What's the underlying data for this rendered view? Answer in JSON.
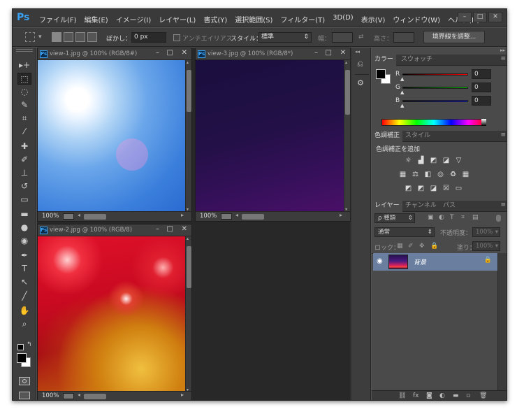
{
  "app": {
    "logo": "Ps",
    "menu": [
      "ファイル(F)",
      "編集(E)",
      "イメージ(I)",
      "レイヤー(L)",
      "書式(Y)",
      "選択範囲(S)",
      "フィルター(T)",
      "3D(D)",
      "表示(V)",
      "ウィンドウ(W)",
      "ヘルプ(H)"
    ],
    "window_buttons": [
      "–",
      "□",
      "✕"
    ]
  },
  "options": {
    "feather_label": "ぼかし：",
    "feather_value": "0 px",
    "antialias_label": "アンチエイリアス",
    "style_label": "スタイル：",
    "style_value": "標準",
    "width_label": "幅：",
    "height_label": "高さ：",
    "refine_button": "境界線を調整..."
  },
  "tools": [
    {
      "icon": "move-icon",
      "glyph": "▸+"
    },
    {
      "icon": "marquee-icon",
      "glyph": "⬚"
    },
    {
      "icon": "lasso-icon",
      "glyph": "◌"
    },
    {
      "icon": "quick-select-icon",
      "glyph": "✎"
    },
    {
      "icon": "crop-icon",
      "glyph": "⌗"
    },
    {
      "icon": "eyedropper-icon",
      "glyph": "⁄"
    },
    {
      "icon": "healing-brush-icon",
      "glyph": "✚"
    },
    {
      "icon": "brush-icon",
      "glyph": "✐"
    },
    {
      "icon": "stamp-icon",
      "glyph": "⊥"
    },
    {
      "icon": "history-brush-icon",
      "glyph": "↺"
    },
    {
      "icon": "eraser-icon",
      "glyph": "▭"
    },
    {
      "icon": "gradient-icon",
      "glyph": "▬"
    },
    {
      "icon": "blur-icon",
      "glyph": "●"
    },
    {
      "icon": "dodge-icon",
      "glyph": "◉"
    },
    {
      "icon": "pen-icon",
      "glyph": "✒"
    },
    {
      "icon": "type-icon",
      "glyph": "T"
    },
    {
      "icon": "path-select-icon",
      "glyph": "↖"
    },
    {
      "icon": "line-icon",
      "glyph": "╱"
    },
    {
      "icon": "hand-icon",
      "glyph": "✋"
    },
    {
      "icon": "zoom-icon",
      "glyph": "⌕"
    }
  ],
  "documents": [
    {
      "title": "view-1.jpg @ 100% (RGB/8#)",
      "zoom": "100%"
    },
    {
      "title": "view-3.jpg @ 100% (RGB/8*)",
      "zoom": "100%"
    },
    {
      "title": "view-2.jpg @ 100% (RGB/8)",
      "zoom": "100%"
    }
  ],
  "color_panel": {
    "tabs": [
      "カラー",
      "スウォッチ"
    ],
    "channels": [
      {
        "label": "R",
        "value": "0",
        "color": "#ff0000"
      },
      {
        "label": "G",
        "value": "0",
        "color": "#00cc00"
      },
      {
        "label": "B",
        "value": "0",
        "color": "#0000ff"
      }
    ]
  },
  "adjust_panel": {
    "tabs": [
      "色調補正",
      "スタイル"
    ],
    "subtitle": "色調補正を追加"
  },
  "layers_panel": {
    "tabs": [
      "レイヤー",
      "チャンネル",
      "パス"
    ],
    "filter_label": "ρ 種類",
    "blend_mode": "通常",
    "opacity_label": "不透明度：",
    "opacity_value": "100%",
    "lock_label": "ロック：",
    "fill_label": "塗り：",
    "fill_value": "100%",
    "layer_name": "背景"
  }
}
